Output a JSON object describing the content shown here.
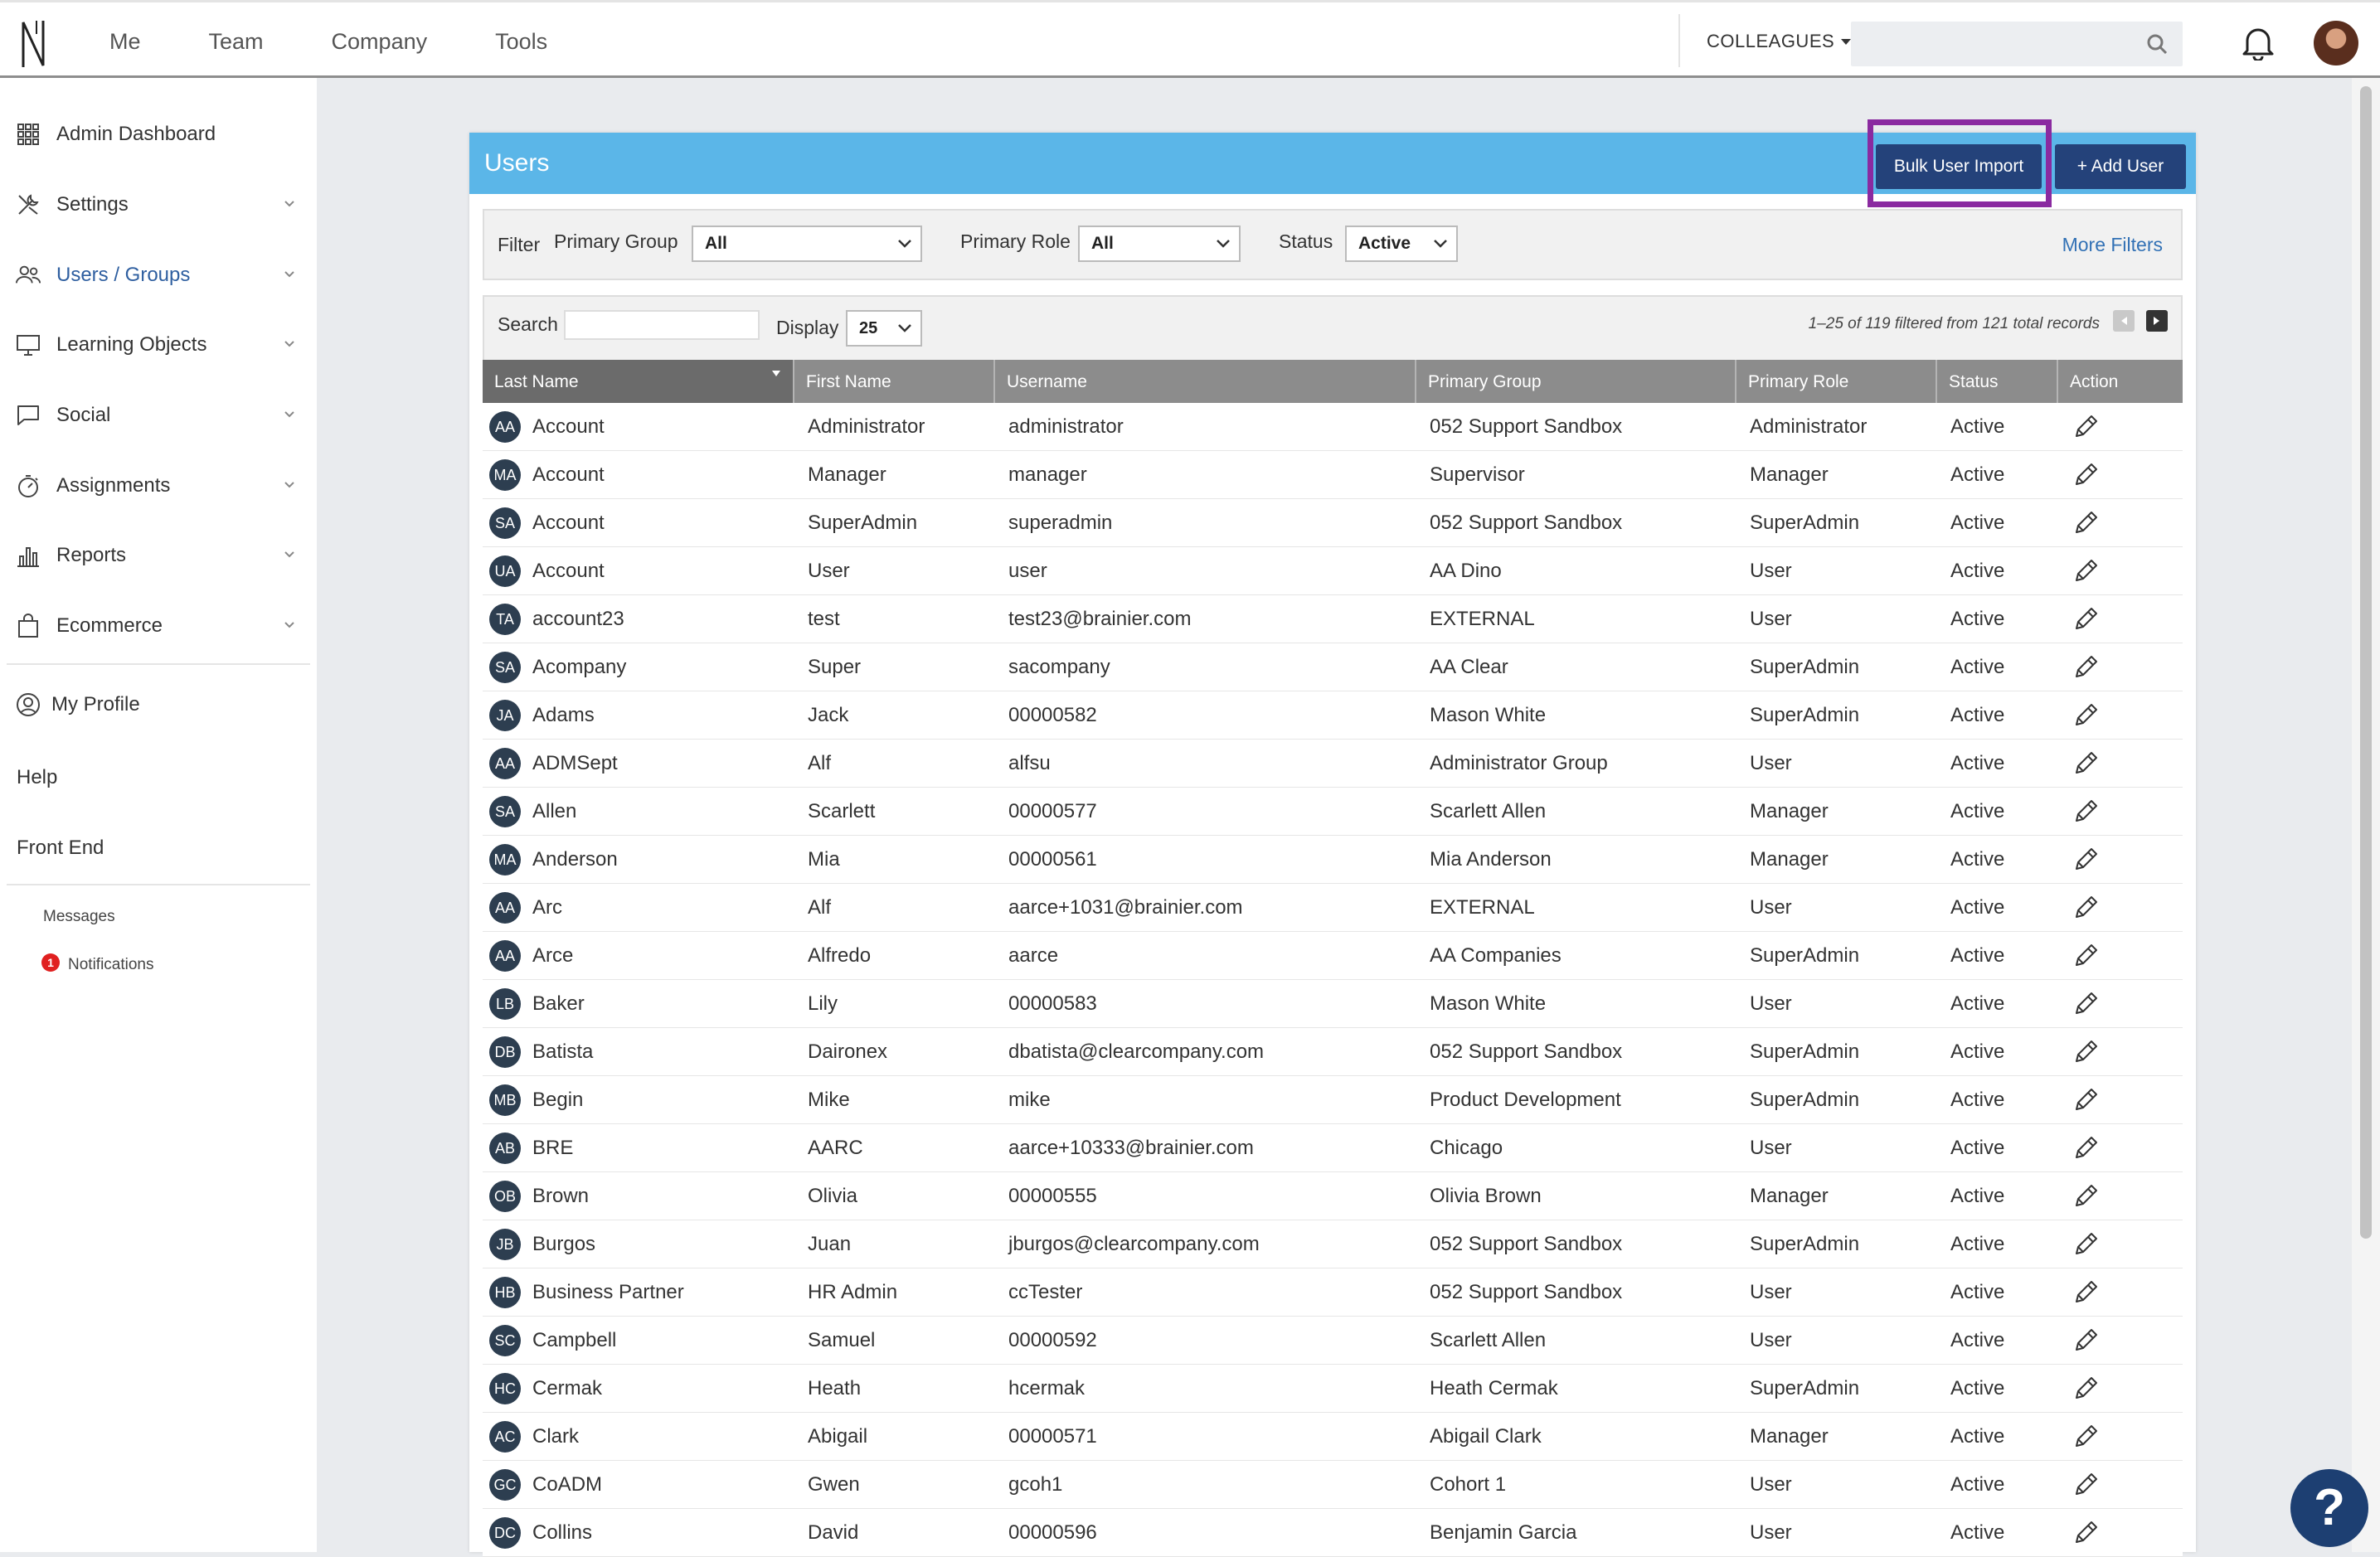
{
  "topnav": {
    "items": [
      "Me",
      "Team",
      "Company",
      "Tools"
    ],
    "colleagues": "COLLEAGUES",
    "search_placeholder": ""
  },
  "sidebar": {
    "items": [
      {
        "label": "Admin Dashboard",
        "icon": "grid-icon"
      },
      {
        "label": "Settings",
        "icon": "tools-icon"
      },
      {
        "label": "Users / Groups",
        "icon": "users-icon"
      },
      {
        "label": "Learning Objects",
        "icon": "monitor-icon"
      },
      {
        "label": "Social",
        "icon": "chat-icon"
      },
      {
        "label": "Assignments",
        "icon": "stopwatch-icon"
      },
      {
        "label": "Reports",
        "icon": "bar-chart-icon"
      },
      {
        "label": "Ecommerce",
        "icon": "shopping-bag-icon"
      }
    ],
    "my_profile": "My Profile",
    "help": "Help",
    "front_end": "Front End",
    "messages": "Messages",
    "notifications": "Notifications",
    "notifications_count": "1"
  },
  "panel": {
    "title": "Users",
    "bulk_import": "Bulk User Import",
    "add_user": "+ Add User"
  },
  "filter": {
    "label": "Filter",
    "primary_group_label": "Primary Group",
    "primary_group_value": "All",
    "primary_role_label": "Primary Role",
    "primary_role_value": "All",
    "status_label": "Status",
    "status_value": "Active",
    "more_filters": "More Filters"
  },
  "table_controls": {
    "search_label": "Search",
    "display_label": "Display",
    "display_value": "25",
    "record_info": "1–25 of 119 filtered from 121 total records"
  },
  "columns": [
    "Last Name",
    "First Name",
    "Username",
    "Primary Group",
    "Primary Role",
    "Status",
    "Action"
  ],
  "rows": [
    {
      "initials": "AA",
      "last": "Account",
      "first": "Administrator",
      "username": "administrator",
      "group": "052 Support Sandbox",
      "role": "Administrator",
      "status": "Active"
    },
    {
      "initials": "MA",
      "last": "Account",
      "first": "Manager",
      "username": "manager",
      "group": "Supervisor",
      "role": "Manager",
      "status": "Active"
    },
    {
      "initials": "SA",
      "last": "Account",
      "first": "SuperAdmin",
      "username": "superadmin",
      "group": "052 Support Sandbox",
      "role": "SuperAdmin",
      "status": "Active"
    },
    {
      "initials": "UA",
      "last": "Account",
      "first": "User",
      "username": "user",
      "group": "AA Dino",
      "role": "User",
      "status": "Active"
    },
    {
      "initials": "TA",
      "last": "account23",
      "first": "test",
      "username": "test23@brainier.com",
      "group": "EXTERNAL",
      "role": "User",
      "status": "Active"
    },
    {
      "initials": "SA",
      "last": "Acompany",
      "first": "Super",
      "username": "sacompany",
      "group": "AA Clear",
      "role": "SuperAdmin",
      "status": "Active"
    },
    {
      "initials": "JA",
      "last": "Adams",
      "first": "Jack",
      "username": "00000582",
      "group": "Mason White",
      "role": "SuperAdmin",
      "status": "Active"
    },
    {
      "initials": "AA",
      "last": "ADMSept",
      "first": "Alf",
      "username": "alfsu",
      "group": "Administrator Group",
      "role": "User",
      "status": "Active"
    },
    {
      "initials": "SA",
      "last": "Allen",
      "first": "Scarlett",
      "username": "00000577",
      "group": "Scarlett Allen",
      "role": "Manager",
      "status": "Active"
    },
    {
      "initials": "MA",
      "last": "Anderson",
      "first": "Mia",
      "username": "00000561",
      "group": "Mia Anderson",
      "role": "Manager",
      "status": "Active"
    },
    {
      "initials": "AA",
      "last": "Arc",
      "first": "Alf",
      "username": "aarce+1031@brainier.com",
      "group": "EXTERNAL",
      "role": "User",
      "status": "Active"
    },
    {
      "initials": "AA",
      "last": "Arce",
      "first": "Alfredo",
      "username": "aarce",
      "group": "AA Companies",
      "role": "SuperAdmin",
      "status": "Active"
    },
    {
      "initials": "LB",
      "last": "Baker",
      "first": "Lily",
      "username": "00000583",
      "group": "Mason White",
      "role": "User",
      "status": "Active"
    },
    {
      "initials": "DB",
      "last": "Batista",
      "first": "Daironex",
      "username": "dbatista@clearcompany.com",
      "group": "052 Support Sandbox",
      "role": "SuperAdmin",
      "status": "Active"
    },
    {
      "initials": "MB",
      "last": "Begin",
      "first": "Mike",
      "username": "mike",
      "group": "Product Development",
      "role": "SuperAdmin",
      "status": "Active"
    },
    {
      "initials": "AB",
      "last": "BRE",
      "first": "AARC",
      "username": "aarce+10333@brainier.com",
      "group": "Chicago",
      "role": "User",
      "status": "Active"
    },
    {
      "initials": "OB",
      "last": "Brown",
      "first": "Olivia",
      "username": "00000555",
      "group": "Olivia Brown",
      "role": "Manager",
      "status": "Active"
    },
    {
      "initials": "JB",
      "last": "Burgos",
      "first": "Juan",
      "username": "jburgos@clearcompany.com",
      "group": "052 Support Sandbox",
      "role": "SuperAdmin",
      "status": "Active"
    },
    {
      "initials": "HB",
      "last": "Business Partner",
      "first": "HR Admin",
      "username": "ccTester",
      "group": "052 Support Sandbox",
      "role": "User",
      "status": "Active"
    },
    {
      "initials": "SC",
      "last": "Campbell",
      "first": "Samuel",
      "username": "00000592",
      "group": "Scarlett Allen",
      "role": "User",
      "status": "Active"
    },
    {
      "initials": "HC",
      "last": "Cermak",
      "first": "Heath",
      "username": "hcermak",
      "group": "Heath Cermak",
      "role": "SuperAdmin",
      "status": "Active"
    },
    {
      "initials": "AC",
      "last": "Clark",
      "first": "Abigail",
      "username": "00000571",
      "group": "Abigail Clark",
      "role": "Manager",
      "status": "Active"
    },
    {
      "initials": "GC",
      "last": "CoADM",
      "first": "Gwen",
      "username": "gcoh1",
      "group": "Cohort 1",
      "role": "User",
      "status": "Active"
    },
    {
      "initials": "DC",
      "last": "Collins",
      "first": "David",
      "username": "00000596",
      "group": "Benjamin Garcia",
      "role": "User",
      "status": "Active"
    }
  ],
  "help_button": "?"
}
